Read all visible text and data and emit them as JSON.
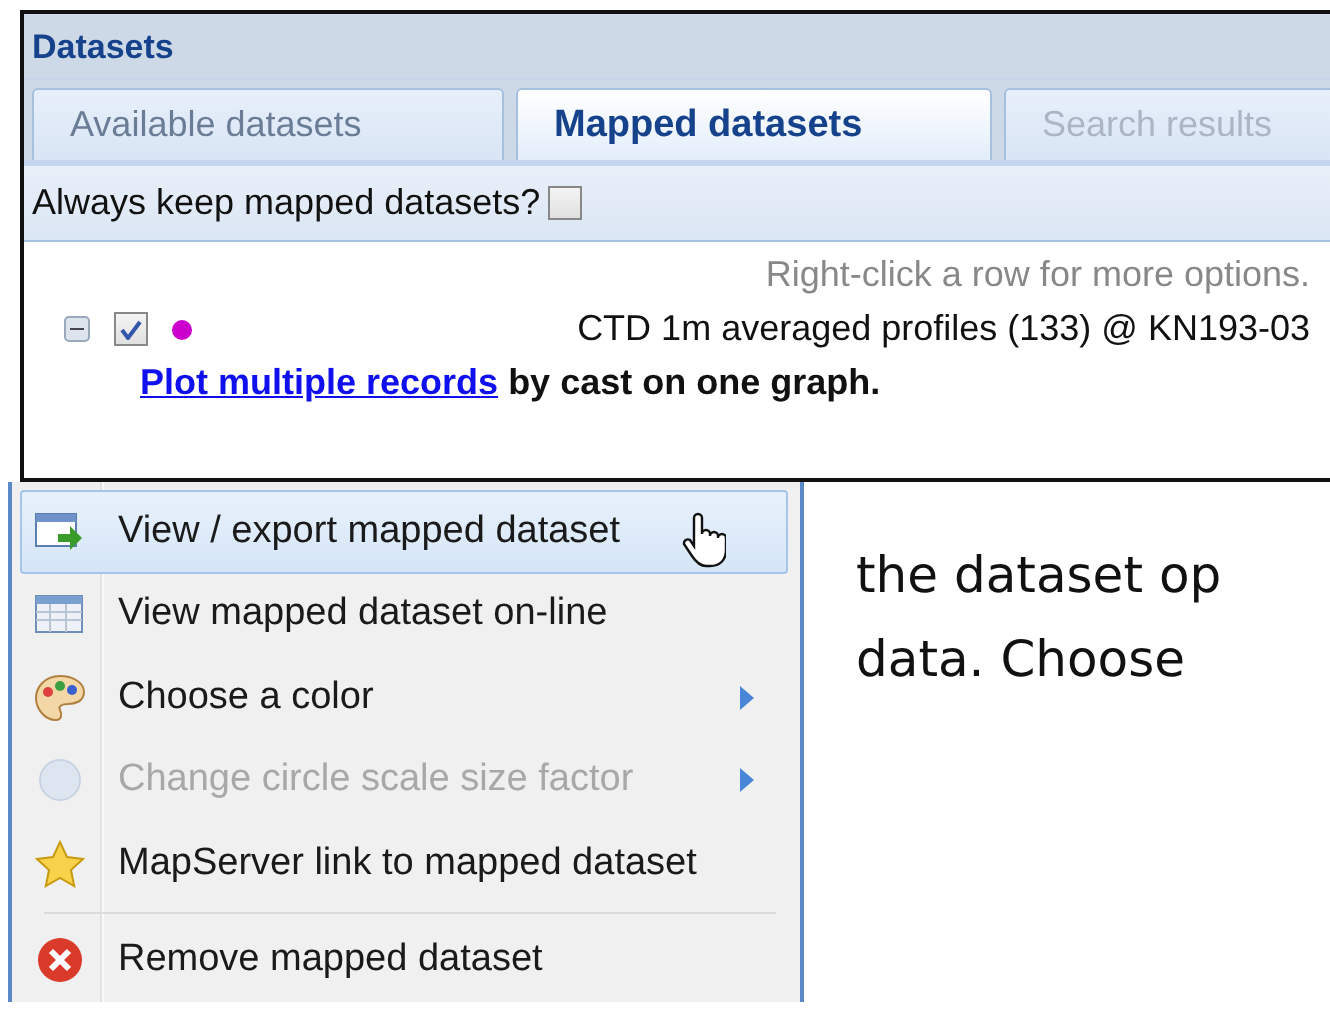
{
  "panel": {
    "title": "Datasets",
    "tabs": [
      {
        "label": "Available datasets",
        "selected": false,
        "disabled": false
      },
      {
        "label": "Mapped datasets",
        "selected": true,
        "disabled": false
      },
      {
        "label": "Search results",
        "selected": false,
        "disabled": true
      }
    ],
    "keep_option": {
      "label": "Always keep mapped datasets?",
      "checked": false
    },
    "hint": "Right-click a row for more options.",
    "dataset": {
      "expanded": true,
      "checked": true,
      "color": "#cc00cc",
      "name": "CTD 1m averaged profiles (133) @ KN193-03",
      "link": "Plot multiple records",
      "note": "by cast on one graph."
    }
  },
  "context_menu": [
    {
      "kind": "export",
      "label": "View / export mapped dataset",
      "selected": true,
      "disabled": false,
      "submenu": false,
      "separator_before": false
    },
    {
      "kind": "table",
      "label": "View mapped dataset on-line",
      "selected": false,
      "disabled": false,
      "submenu": false,
      "separator_before": false
    },
    {
      "kind": "palette",
      "label": "Choose a color",
      "selected": false,
      "disabled": false,
      "submenu": true,
      "separator_before": false
    },
    {
      "kind": "circle",
      "label": "Change circle scale size factor",
      "selected": false,
      "disabled": true,
      "submenu": true,
      "separator_before": false
    },
    {
      "kind": "star",
      "label": "MapServer link to mapped dataset",
      "selected": false,
      "disabled": false,
      "submenu": false,
      "separator_before": false
    },
    {
      "kind": "remove",
      "label": "Remove mapped dataset",
      "selected": false,
      "disabled": false,
      "submenu": false,
      "separator_before": true
    }
  ],
  "body_text": [
    "the dataset op",
    "data. Choose"
  ]
}
